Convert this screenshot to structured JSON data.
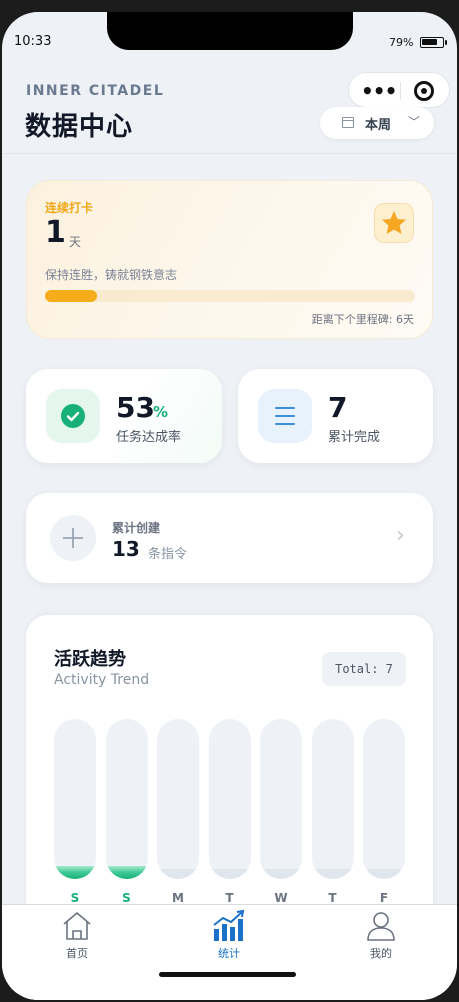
{
  "status": {
    "time": "10:33",
    "battery": "79%",
    "battery_level": 0.79
  },
  "header": {
    "brand": "INNER CITADEL",
    "title": "数据中心",
    "period": "本周"
  },
  "streak": {
    "label": "连续打卡",
    "days": "1",
    "unit": "天",
    "motto": "保持连胜，铸就钢铁意志",
    "progress": 0.14,
    "milestone": "距离下个里程碑: 6天"
  },
  "stats": {
    "completion_rate": {
      "value": "53",
      "suffix": "%",
      "caption": "任务达成率"
    },
    "total_done": {
      "value": "7",
      "caption": "累计完成"
    },
    "created": {
      "label": "累计创建",
      "value": "13",
      "unit": "条指令"
    }
  },
  "trend": {
    "title": "活跃趋势",
    "subtitle": "Activity Trend",
    "total": "Total: 7"
  },
  "chart_data": {
    "type": "bar",
    "categories": [
      "S",
      "S",
      "M",
      "T",
      "W",
      "T",
      "F"
    ],
    "values": [
      0.08,
      0.08,
      0,
      0,
      0,
      0,
      0
    ],
    "active": [
      true,
      true,
      false,
      false,
      false,
      false,
      false
    ]
  },
  "tabs": [
    {
      "label": "首页",
      "icon": "home-icon",
      "active": false
    },
    {
      "label": "统计",
      "icon": "stats-icon",
      "active": true
    },
    {
      "label": "我的",
      "icon": "profile-icon",
      "active": false
    }
  ],
  "colors": {
    "accent": "#18b07a",
    "streak": "#f6ad1c",
    "tab_active": "#1a73c8"
  }
}
